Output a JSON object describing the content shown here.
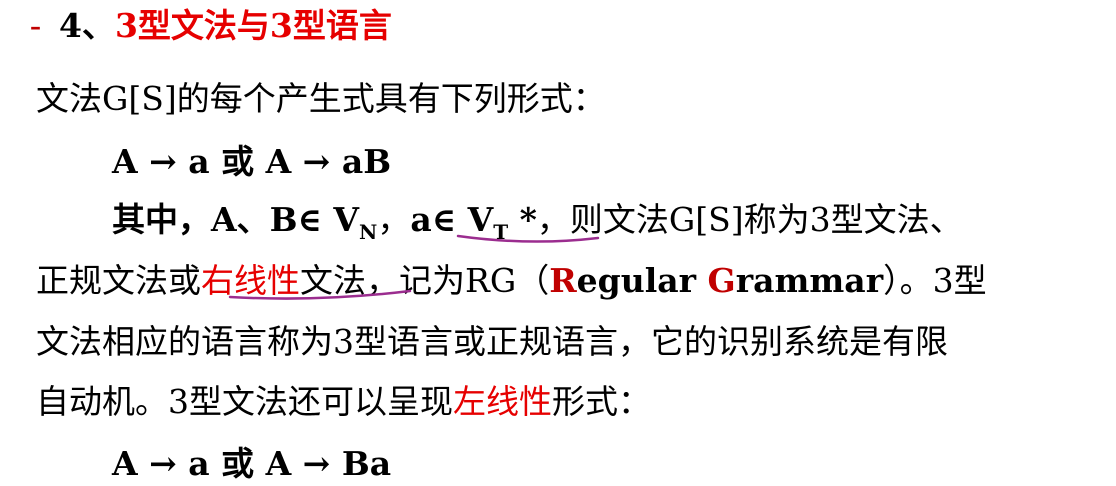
{
  "heading": {
    "dash": "–",
    "number": "4、",
    "title": "3型文法与3型语言"
  },
  "para": {
    "intro": "文法G[S]的每个产生式具有下列形式：",
    "forms1": "A → a  或  A → aB",
    "l4_a": "其中，A、B∈ V",
    "sub_n": "N",
    "l4_b": "，",
    "l4_c": "a∈ V",
    "sub_t": "T",
    "l4_d": " *",
    "l4_e": "，则文法G[S]称为3型文法、",
    "l5_a": "正规文法或",
    "right_linear": "右线性",
    "l5_b": "文法，记为RG（",
    "R": "R",
    "egular": "egular ",
    "G": "G",
    "rammar": "rammar",
    "l5_c": "）。3型",
    "l6": "文法相应的语言称为3型语言或正规语言，它的识别系统是有限",
    "l7_a": "自动机。3型文法还可以呈现",
    "left_linear": "左线性",
    "l7_b": "形式：",
    "forms2": "A → a  或  A → Ba"
  },
  "colors": {
    "title_red": "#e60000",
    "dash_red": "#c00000",
    "annotation_purple": "#9b2d8f"
  }
}
